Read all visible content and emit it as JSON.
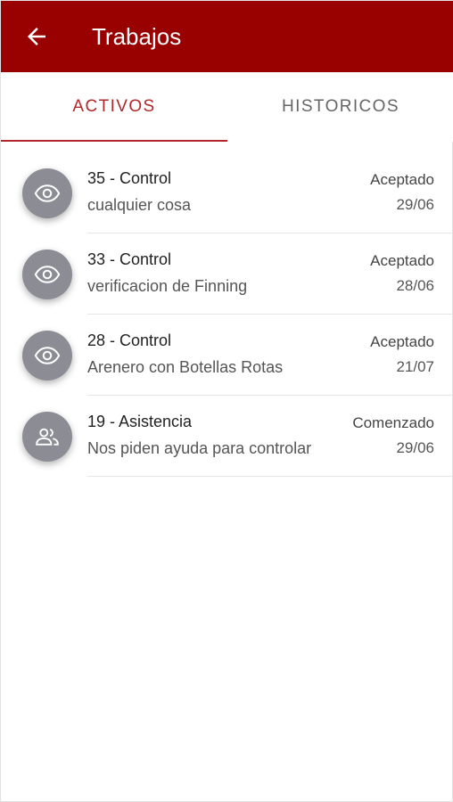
{
  "header": {
    "title": "Trabajos",
    "back_icon": "arrow-left-icon",
    "color": "#990000"
  },
  "tabs": [
    {
      "label": "ACTIVOS",
      "active": true
    },
    {
      "label": "HISTORICOS",
      "active": false
    }
  ],
  "accent": "#b0282a",
  "jobs": [
    {
      "title": "35 - Control",
      "description": "cualquier cosa",
      "status": "Aceptado",
      "date": "29/06",
      "icon": "eye-icon"
    },
    {
      "title": "33 - Control",
      "description": "verificacion de Finning",
      "status": "Aceptado",
      "date": "28/06",
      "icon": "eye-icon"
    },
    {
      "title": "28 - Control",
      "description": "Arenero con Botellas Rotas",
      "status": "Aceptado",
      "date": "21/07",
      "icon": "eye-icon"
    },
    {
      "title": "19 - Asistencia",
      "description": "Nos piden ayuda para controlar",
      "status": "Comenzado",
      "date": "29/06",
      "icon": "people-icon"
    }
  ]
}
